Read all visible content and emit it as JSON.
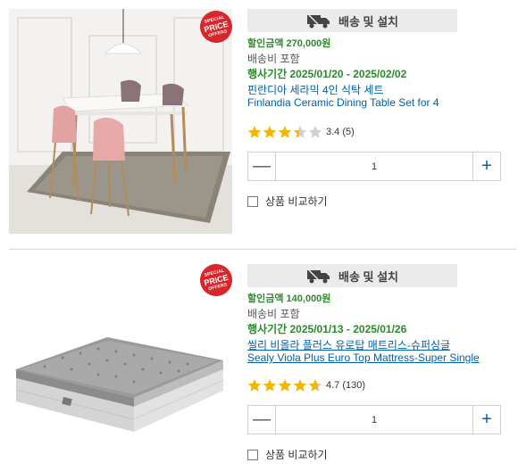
{
  "products": [
    {
      "badge": {
        "line1": "SPECIAL",
        "line2": "PRICE",
        "line3": "OFFERS"
      },
      "delivery_label": "배송 및 설치",
      "delivery_icon": "truck-icon",
      "discount": "할인금액 270,000원",
      "shipping": "배송비 포함",
      "period": "행사기간 2025/01/20 - 2025/02/02",
      "name_ko": "핀란디아 세라믹 4인 식탁 세트",
      "name_en": "Finlandia Ceramic Dining Table Set for 4",
      "rating": 3.4,
      "rating_text": "3.4 (5)",
      "quantity": "1",
      "compare_label": "상품 비교하기",
      "image": "dining-table-set-photo"
    },
    {
      "badge": {
        "line1": "SPECIAL",
        "line2": "PRICE",
        "line3": "OFFERS"
      },
      "delivery_label": "배송 및 설치",
      "delivery_icon": "truck-icon",
      "discount": "할인금액 140,000원",
      "shipping": "배송비 포함",
      "period": "행사기간 2025/01/13 - 2025/01/26",
      "name_ko": "씰리 비올라 플러스 유로탑 매트리스-슈퍼싱글",
      "name_en": "Sealy Viola Plus Euro Top Mattress-Super Single",
      "rating": 4.7,
      "rating_text": "4.7 (130)",
      "quantity": "1",
      "compare_label": "상품 비교하기",
      "image": "mattress-photo"
    }
  ],
  "controls": {
    "minus": "—",
    "plus": "+"
  },
  "colors": {
    "green": "#2a8a2a",
    "link": "#0060a9",
    "badge_red": "#d9262c",
    "star": "#f5b400"
  }
}
